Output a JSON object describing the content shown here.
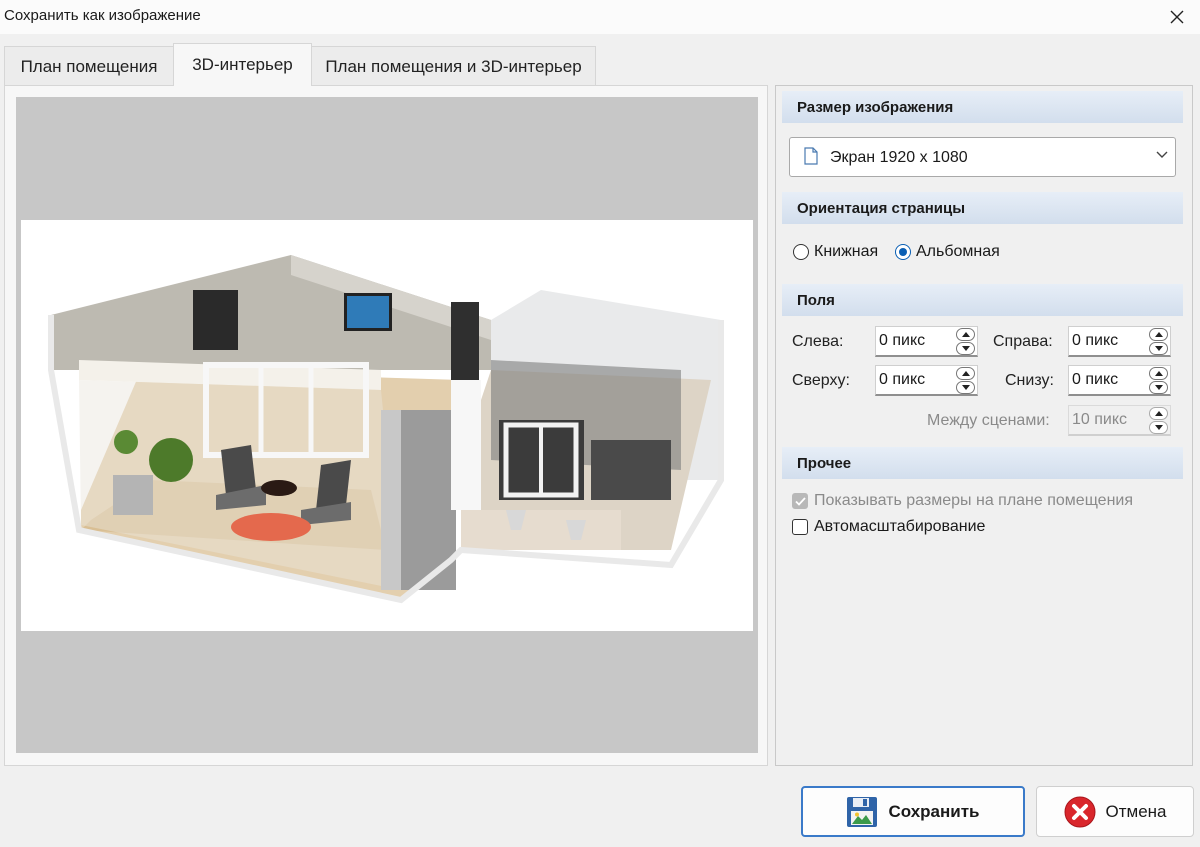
{
  "window": {
    "title": "Сохранить как изображение"
  },
  "tabs": [
    {
      "label": "План помещения"
    },
    {
      "label": "3D-интерьер",
      "active": true
    },
    {
      "label": "План помещения и 3D-интерьер"
    }
  ],
  "image_size": {
    "header": "Размер изображения",
    "selected": "Экран 1920 x 1080"
  },
  "orientation": {
    "header": "Ориентация страницы",
    "portrait_label": "Книжная",
    "landscape_label": "Альбомная",
    "selected": "landscape"
  },
  "margins": {
    "header": "Поля",
    "left_label": "Слева:",
    "left_value": "0 пикс",
    "right_label": "Справа:",
    "right_value": "0 пикс",
    "top_label": "Сверху:",
    "top_value": "0 пикс",
    "bottom_label": "Снизу:",
    "bottom_value": "0 пикс",
    "between_label": "Между сценами:",
    "between_value": "10 пикс"
  },
  "other": {
    "header": "Прочее",
    "show_dimensions_label": "Показывать размеры на плане помещения",
    "show_dimensions_checked": true,
    "show_dimensions_disabled": true,
    "autoscale_label": "Автомасштабирование",
    "autoscale_checked": false
  },
  "buttons": {
    "save_label": "Сохранить",
    "cancel_label": "Отмена"
  },
  "colors": {
    "accent": "#0a5fb4",
    "section_header": "#d9e4f1",
    "preview_bg": "#c7c7c7",
    "cancel_icon": "#d9262c"
  },
  "icons": {
    "close": "close-icon",
    "document": "document-icon",
    "dropdown": "chevron-down-icon",
    "save": "floppy-disk-icon",
    "cancel": "cancel-x-circle-icon",
    "spin_up": "arrow-up-icon",
    "spin_down": "arrow-down-icon"
  }
}
